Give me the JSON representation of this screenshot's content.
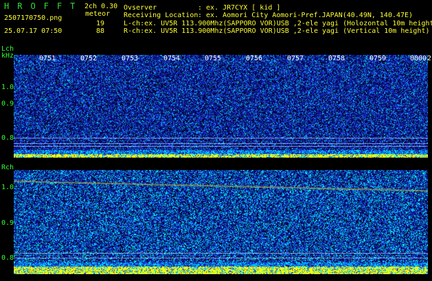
{
  "header": {
    "brand": "HROFFT",
    "version": "2ch 0.30",
    "mode_label": "meteor",
    "filename": "2507170750.png",
    "datetime": "25.07.17 07:50",
    "count_l": "19",
    "count_r": "88",
    "observer_label": "Ovserver",
    "observer_value": ": ex. JR7CYX [ kid ]",
    "location_label": "Receiving Location",
    "location_value": ": ex. Aomori City Aomori-Pref.JAPAN(40.49N, 140.47E)",
    "lch_info": "L-ch:ex. UV5R 113.900Mhz(SAPPORO VOR)USB ,2-ele yagi (Holozontal 10m height)",
    "rch_info": "R-ch:ex. UV5R 113.900Mhz(SAPPORO VOR)USB ,2-ele yagi (Vertical 10m height)"
  },
  "panels": {
    "lch": {
      "channel": "Lch",
      "unit": "kHz",
      "y_ticks": [
        "1.0",
        "0.9",
        "0.8"
      ],
      "time_ticks": [
        "0751",
        "0752",
        "0753",
        "0754",
        "0755",
        "0756",
        "0757",
        "0758",
        "0759",
        "0800",
        "2"
      ]
    },
    "rch": {
      "channel": "Rch",
      "y_ticks": [
        "1.0",
        "0.9",
        "0.8"
      ]
    }
  },
  "colors": {
    "background": "#000000",
    "noise_low": "#0a0a8c",
    "noise_mid": "#1e3cff",
    "noise_high": "#00ffff",
    "signal_bar": "#ffff00",
    "label_green": "#33dd33",
    "label_yellow": "#ffff33"
  }
}
